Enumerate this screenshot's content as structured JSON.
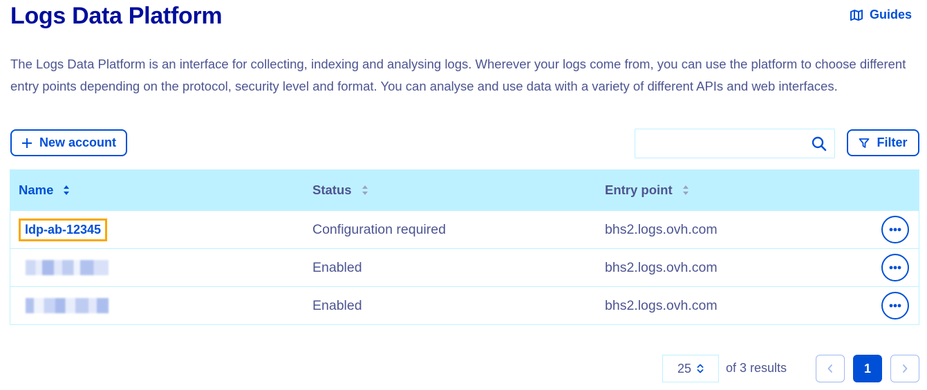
{
  "header": {
    "title": "Logs Data Platform",
    "guides_label": "Guides",
    "guides_icon": "book-map-icon"
  },
  "description": "The Logs Data Platform is an interface for collecting, indexing and analysing logs. Wherever your logs come from, you can use the platform to choose different entry points depending on the protocol, security level and format. You can analyse and use data with a variety of different APIs and web interfaces.",
  "toolbar": {
    "new_account_label": "New account",
    "search_value": "",
    "search_placeholder": "",
    "filter_label": "Filter"
  },
  "table": {
    "columns": {
      "name": "Name",
      "status": "Status",
      "entry_point": "Entry point"
    },
    "rows": [
      {
        "name": "ldp-ab-12345",
        "status": "Configuration required",
        "entry_point": "bhs2.logs.ovh.com",
        "name_redacted": false
      },
      {
        "name": "",
        "status": "Enabled",
        "entry_point": "bhs2.logs.ovh.com",
        "name_redacted": true
      },
      {
        "name": "",
        "status": "Enabled",
        "entry_point": "bhs2.logs.ovh.com",
        "name_redacted": true
      }
    ]
  },
  "pagination": {
    "page_size": "25",
    "count_label": "of 3 results",
    "current_page": "1"
  },
  "colors": {
    "title": "#000e9c",
    "accent": "#0050d7",
    "header_bg": "#bef1ff",
    "text": "#4d5592",
    "highlight": "#f9a800"
  }
}
